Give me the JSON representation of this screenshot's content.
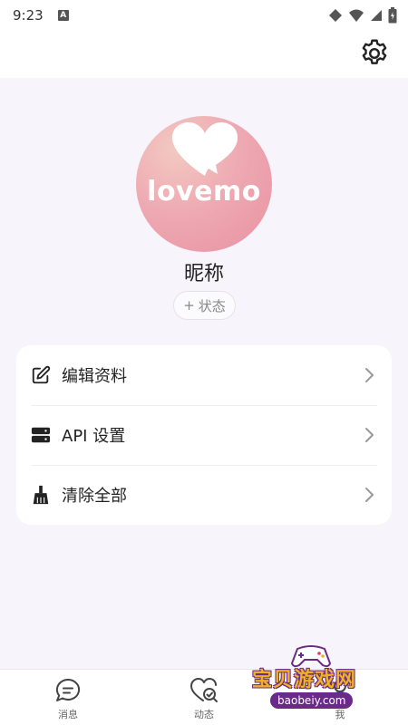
{
  "status_bar": {
    "time": "9:23",
    "notification_badge": "A"
  },
  "profile": {
    "avatar_text": "lovemo",
    "nickname": "昵称",
    "status_chip": {
      "plus": "+",
      "label": "状态"
    }
  },
  "menu": {
    "items": [
      {
        "icon": "edit-icon",
        "label": "编辑资料"
      },
      {
        "icon": "server-icon",
        "label": "API 设置"
      },
      {
        "icon": "broom-icon",
        "label": "清除全部"
      }
    ]
  },
  "bottom_nav": {
    "items": [
      {
        "icon": "chat-bubble-icon",
        "label": "消息"
      },
      {
        "icon": "heart-search-icon",
        "label": "动态"
      },
      {
        "icon": "person-icon",
        "label": "我"
      }
    ]
  },
  "watermark": {
    "title": "宝贝游戏网",
    "url": "baobeiy.com"
  },
  "colors": {
    "background": "#f7f4fb",
    "card": "#ffffff",
    "avatar_gradient_start": "#f3c9c2",
    "avatar_gradient_end": "#e891a2",
    "text_primary": "#222222",
    "text_secondary": "#888888"
  }
}
